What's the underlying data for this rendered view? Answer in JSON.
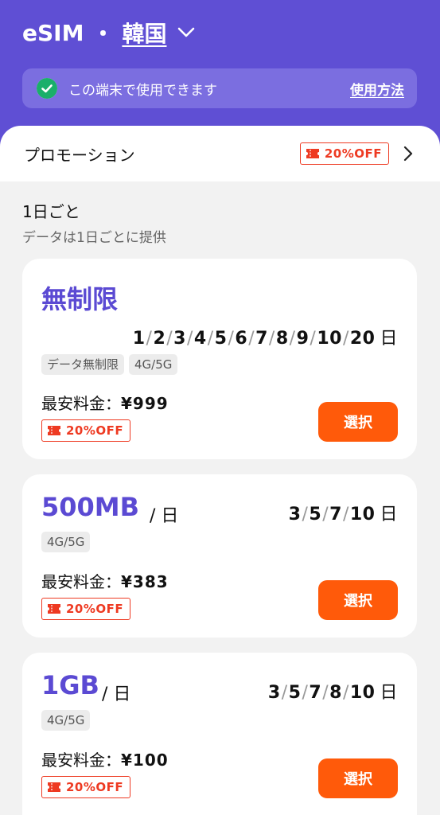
{
  "header": {
    "esim": "eSIM",
    "dot": "・",
    "country": "韓国",
    "compat_text": "この端末で使用できます",
    "compat_link": "使用方法"
  },
  "promo": {
    "label": "プロモーション",
    "badge": "20%OFF"
  },
  "section": {
    "title": "1日ごと",
    "subtitle": "データは1日ごとに提供"
  },
  "plans": [
    {
      "name": "無制限",
      "per_day": "",
      "days": [
        "1",
        "2",
        "3",
        "4",
        "5",
        "6",
        "7",
        "8",
        "9",
        "10",
        "20"
      ],
      "day_unit": "日",
      "chips": [
        "データ無制限",
        "4G/5G"
      ],
      "price_label": "最安料金：",
      "price": "¥999",
      "badge": "20%OFF",
      "button": "選択"
    },
    {
      "name": "500MB",
      "per_day": "/ 日",
      "days": [
        "3",
        "5",
        "7",
        "10"
      ],
      "day_unit": "日",
      "chips": [
        "4G/5G"
      ],
      "price_label": "最安料金：",
      "price": "¥383",
      "badge": "20%OFF",
      "button": "選択"
    },
    {
      "name": "1GB",
      "per_day": "/ 日",
      "days": [
        "3",
        "5",
        "7",
        "8",
        "10"
      ],
      "day_unit": "日",
      "chips": [
        "4G/5G"
      ],
      "price_label": "最安料金：",
      "price": "¥100",
      "badge": "20%OFF",
      "button": "選択"
    }
  ],
  "colors": {
    "header_bg": "#5f4fd4",
    "accent_purple": "#5b4ad3",
    "button_orange": "#ff5a0a",
    "badge_red": "#ee3a22"
  }
}
